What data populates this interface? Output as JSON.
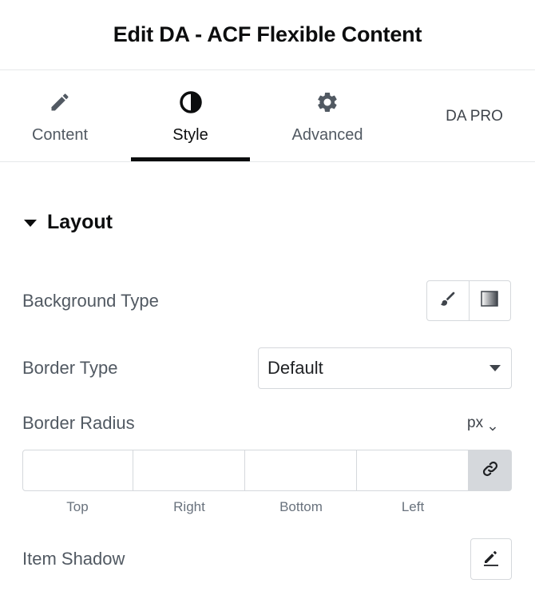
{
  "header": {
    "title": "Edit DA - ACF Flexible Content"
  },
  "tabs": [
    {
      "label": "Content",
      "icon": "pencil-icon"
    },
    {
      "label": "Style",
      "icon": "half-circle-icon",
      "active": true
    },
    {
      "label": "Advanced",
      "icon": "gear-icon"
    },
    {
      "label": "DA PRO"
    }
  ],
  "section": {
    "title": "Layout",
    "expanded": true
  },
  "controls": {
    "background_type": {
      "label": "Background Type",
      "options": [
        "brush-icon",
        "gradient-icon"
      ]
    },
    "border_type": {
      "label": "Border Type",
      "value": "Default"
    },
    "border_radius": {
      "label": "Border Radius",
      "unit": "px",
      "top": "",
      "right": "",
      "bottom": "",
      "left": "",
      "sides": [
        "Top",
        "Right",
        "Bottom",
        "Left"
      ],
      "link_icon": "link-icon"
    },
    "item_shadow": {
      "label": "Item Shadow",
      "edit_icon": "edit-pencil-icon"
    }
  },
  "colors": {
    "text_dark": "#0c0d0e",
    "text_muted": "#515962",
    "border": "#d5d8dc",
    "divider": "#e6e8ea"
  }
}
